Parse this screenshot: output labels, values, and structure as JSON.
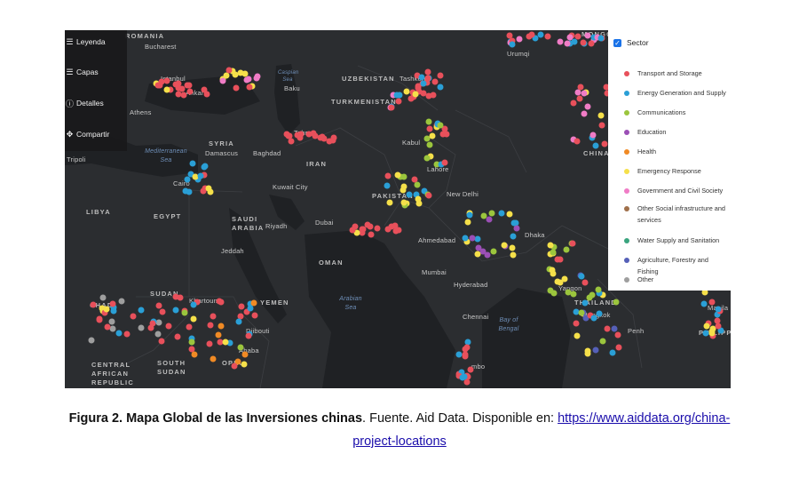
{
  "side_panel": {
    "items": [
      {
        "label": "Leyenda",
        "icon": "list-icon"
      },
      {
        "label": "Capas",
        "icon": "layers-icon"
      },
      {
        "label": "Detalles",
        "icon": "info-icon"
      },
      {
        "label": "Compartir",
        "icon": "share-icon"
      }
    ]
  },
  "legend": {
    "title": "Sector",
    "checked": true,
    "items": [
      {
        "label": "Transport and Storage",
        "color": "#e8505b"
      },
      {
        "label": "Energy Generation and Supply",
        "color": "#2a9fd6"
      },
      {
        "label": "Communications",
        "color": "#9bc53d"
      },
      {
        "label": "Education",
        "color": "#9b4fb5"
      },
      {
        "label": "Health",
        "color": "#f08a24"
      },
      {
        "label": "Emergency Response",
        "color": "#f5e04a"
      },
      {
        "label": "Government and Civil Society",
        "color": "#f07cc6"
      },
      {
        "label": "Other Social infrastructure and services",
        "color": "#a0704a"
      },
      {
        "label": "Water Supply and Sanitation",
        "color": "#3aa47e"
      },
      {
        "label": "Agriculture, Forestry and Fishing",
        "color": "#5560b8"
      },
      {
        "label": "Other",
        "color": "#9e9e9e"
      }
    ]
  },
  "map_labels": {
    "romania": "ROMANIA",
    "bucharest": "Bucharest",
    "istanbul": "Istanbul",
    "ankara": "Ankara",
    "athens": "Athens",
    "tripoli": "Tripoli",
    "cairo": "Cairo",
    "libya": "LIBYA",
    "egypt": "EGYPT",
    "syria": "SYRIA",
    "damascus": "Damascus",
    "baghdad": "Baghdad",
    "iran": "IRAN",
    "tehran": "Tehran",
    "baku": "Baku",
    "turkmenistan": "TURKMENISTAN",
    "uzbekistan": "UZBEKISTAN",
    "tashkent": "Tashkent",
    "kabul": "Kabul",
    "lahore": "Lahore",
    "pakistan": "PAKISTAN",
    "new_delhi": "New Delhi",
    "ahmedabad": "Ahmedabad",
    "mumbai": "Mumbai",
    "hyderabad": "Hyderabad",
    "chennai": "Chennai",
    "kuwait_city": "Kuwait City",
    "saudi_arabia": "SAUDI ARABIA",
    "riyadh": "Riyadh",
    "dubai": "Dubai",
    "oman": "OMAN",
    "jeddah": "Jeddah",
    "yemen": "YEMEN",
    "sudan": "SUDAN",
    "khartoum": "Khartoum",
    "chad": "CHAD",
    "djibouti": "Djibouti",
    "ethiopia": "OPIA",
    "addis": "Ababa",
    "central_african_republic": "CENTRAL AFRICAN REPUBLIC",
    "south_sudan": "SOUTH SUDAN",
    "china": "CHINA",
    "urumqi": "Urumqi",
    "mongolia": "MONGO",
    "dhaka": "Dhaka",
    "yangon": "Yangon",
    "thailand": "THAILAND",
    "bangkok": "Bangkok",
    "phnom_penh": "Penh",
    "manila": "Manila",
    "philippines": "PHILIPPI",
    "colombo": "mbo",
    "mediterranean_sea": "Mediterranean Sea",
    "caspian_sea": "Caspian Sea",
    "arabian_sea": "Arabian Sea",
    "bay_of_bengal": "Bay of Bengal"
  },
  "caption": {
    "bold": "Figura 2. Mapa Global de las Inversiones chinas",
    "text": ". Fuente. Aid Data. Disponible en: ",
    "link_line1": "https://www.aiddata.org/china-",
    "link_line2": "project-locations"
  }
}
